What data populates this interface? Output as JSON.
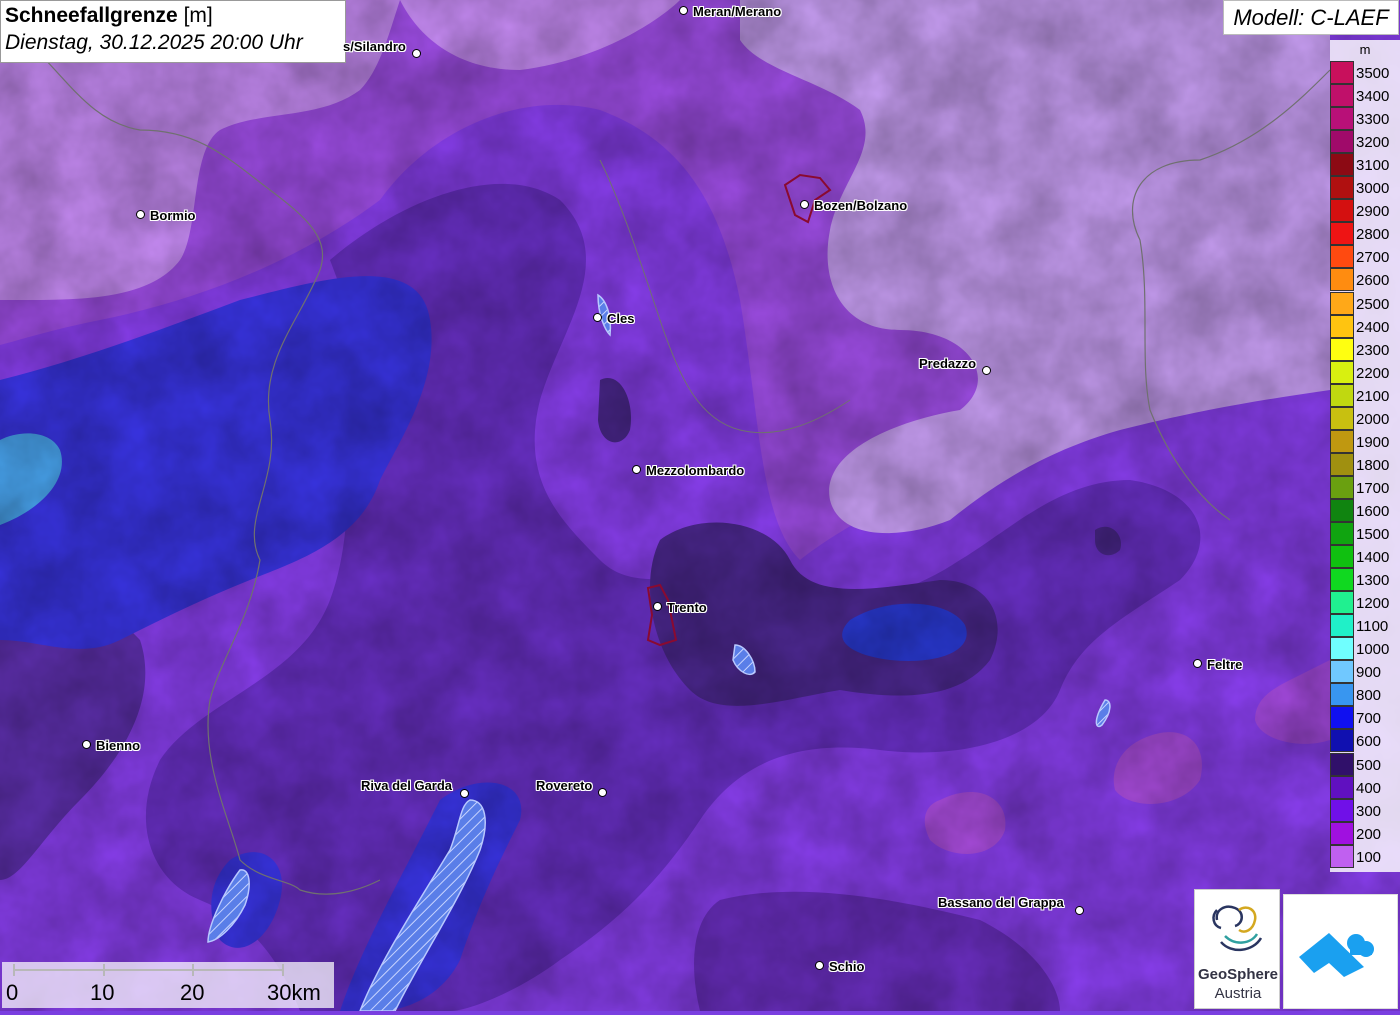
{
  "title": {
    "main": "Schneefallgrenze",
    "unit": "[m]",
    "date": "Dienstag, 30.12.2025 20:00 Uhr"
  },
  "model": "Modell: C-LAEF",
  "legend": {
    "unit": "m",
    "entries": [
      {
        "label": "3500",
        "color": "#c8105c"
      },
      {
        "label": "3400",
        "color": "#c0106a"
      },
      {
        "label": "3300",
        "color": "#b81078"
      },
      {
        "label": "3200",
        "color": "#a00a6a"
      },
      {
        "label": "3100",
        "color": "#8c0a14"
      },
      {
        "label": "3000",
        "color": "#b01010"
      },
      {
        "label": "2900",
        "color": "#d41010"
      },
      {
        "label": "2800",
        "color": "#ee1414"
      },
      {
        "label": "2700",
        "color": "#ff4a10"
      },
      {
        "label": "2600",
        "color": "#ff8c10"
      },
      {
        "label": "2500",
        "color": "#ffa818"
      },
      {
        "label": "2400",
        "color": "#ffc410"
      },
      {
        "label": "2300",
        "color": "#ffff10"
      },
      {
        "label": "2200",
        "color": "#d8f010"
      },
      {
        "label": "2100",
        "color": "#c0d810"
      },
      {
        "label": "2000",
        "color": "#c8c010"
      },
      {
        "label": "1900",
        "color": "#c09810"
      },
      {
        "label": "1800",
        "color": "#a09010"
      },
      {
        "label": "1700",
        "color": "#6aa010"
      },
      {
        "label": "1600",
        "color": "#108410"
      },
      {
        "label": "1500",
        "color": "#10a410"
      },
      {
        "label": "1400",
        "color": "#10c010"
      },
      {
        "label": "1300",
        "color": "#10d820"
      },
      {
        "label": "1200",
        "color": "#20f090"
      },
      {
        "label": "1100",
        "color": "#20f0c8"
      },
      {
        "label": "1000",
        "color": "#70ffff"
      },
      {
        "label": "900",
        "color": "#70c8ff"
      },
      {
        "label": "800",
        "color": "#3896f0"
      },
      {
        "label": "700",
        "color": "#1010f0"
      },
      {
        "label": "600",
        "color": "#1010b0"
      },
      {
        "label": "500",
        "color": "#30106a"
      },
      {
        "label": "400",
        "color": "#6010c0"
      },
      {
        "label": "300",
        "color": "#7010e8"
      },
      {
        "label": "200",
        "color": "#a010e0"
      },
      {
        "label": "100",
        "color": "#c060f0"
      }
    ]
  },
  "cities": [
    {
      "name": "Meran/Merano"
    },
    {
      "name": "s/Silandro"
    },
    {
      "name": "Bormio"
    },
    {
      "name": "Bozen/Bolzano"
    },
    {
      "name": "Cles"
    },
    {
      "name": "Predazzo"
    },
    {
      "name": "Mezzolombardo"
    },
    {
      "name": "Trento"
    },
    {
      "name": "Feltre"
    },
    {
      "name": "Bienno"
    },
    {
      "name": "Riva del Garda"
    },
    {
      "name": "Rovereto"
    },
    {
      "name": "Bassano del Grappa"
    },
    {
      "name": "Schio"
    }
  ],
  "scale": {
    "labels": [
      "0",
      "10",
      "20",
      "30km"
    ]
  },
  "logos": {
    "geosphere_line1": "GeoSphere",
    "geosphere_line2": "Austria"
  },
  "colors": {
    "snowline_100": "#c78cf5",
    "snowline_200": "#9c50e8",
    "snowline_300": "#8a3ff0",
    "snowline_400": "#6a2ec0",
    "snowline_500": "#4a2590",
    "snowline_700": "#3030e0",
    "snowline_800": "#4aa0f0",
    "accent_pink": "#c040d0"
  }
}
